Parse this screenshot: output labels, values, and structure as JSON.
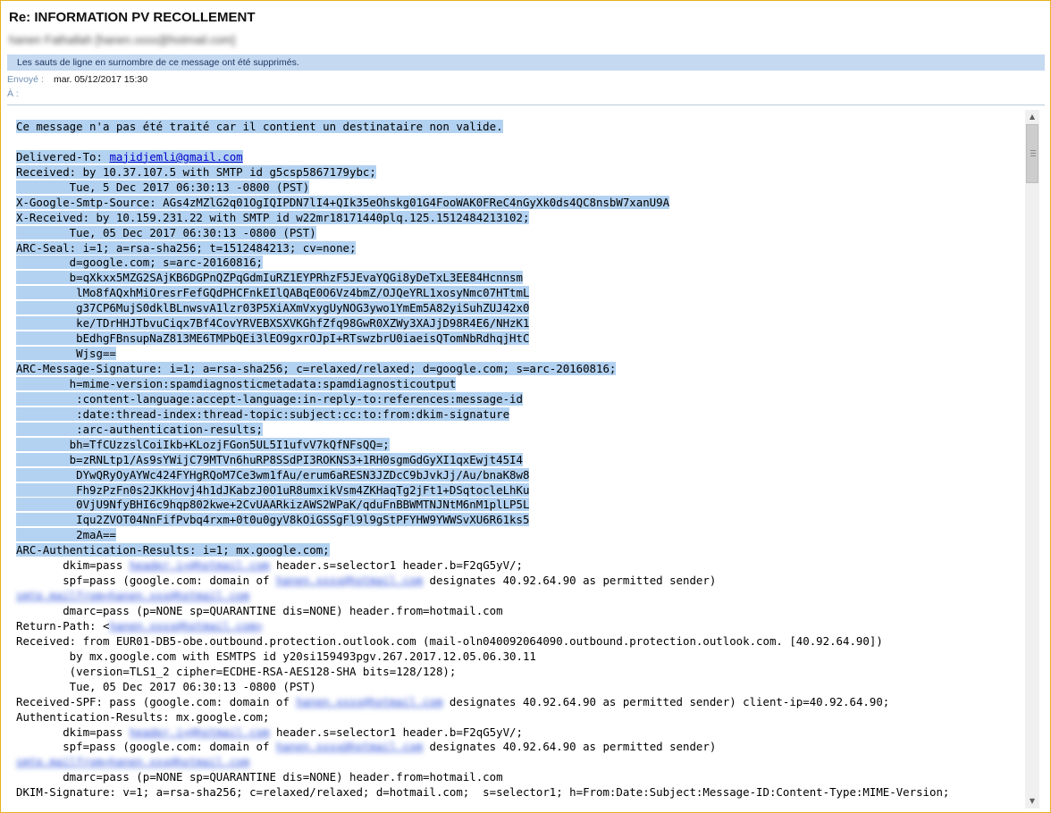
{
  "email": {
    "subject": "Re: INFORMATION PV RECOLLEMENT",
    "sender": "hanen Fathallah [hanen.xxxx@hotmail.com]",
    "info_bar": "Les sauts de ligne en surnombre de ce message ont été supprimés.",
    "sent_label": "Envoyé :",
    "sent_value": "mar. 05/12/2017 15:30",
    "to_label": "À :",
    "to_value": ""
  },
  "body_lines": [
    {
      "text": "Ce message n'a pas été traité car il contient un destinataire non valide.",
      "sel": true
    },
    {
      "text": "",
      "sel": false
    },
    {
      "text": "Delivered-To: ",
      "link": "majidjemli@gmail.com",
      "sel": true
    },
    {
      "text": "Received: by 10.37.107.5 with SMTP id g5csp5867179ybc;",
      "sel": true
    },
    {
      "text": "        Tue, 5 Dec 2017 06:30:13 -0800 (PST)",
      "sel": true
    },
    {
      "text": "X-Google-Smtp-Source: AGs4zMZlG2q01OgIQIPDN7lI4+QIk35eOhskg01G4FooWAK0FReC4nGyXk0ds4QC8nsbW7xanU9A",
      "sel": true
    },
    {
      "text": "X-Received: by 10.159.231.22 with SMTP id w22mr18171440plq.125.1512484213102;",
      "sel": true
    },
    {
      "text": "        Tue, 05 Dec 2017 06:30:13 -0800 (PST)",
      "sel": true
    },
    {
      "text": "ARC-Seal: i=1; a=rsa-sha256; t=1512484213; cv=none;",
      "sel": true
    },
    {
      "text": "        d=google.com; s=arc-20160816;",
      "sel": true
    },
    {
      "text": "        b=qXkxx5MZG2SAjKB6DGPnQZPqGdmIuRZ1EYPRhzF5JEvaYQGi8yDeTxL3EE84Hcnnsm",
      "sel": true
    },
    {
      "text": "         lMo8fAQxhMiOresrFefGQdPHCFnkEIlQABqE0O6Vz4bmZ/OJQeYRL1xosyNmc07HTtmL",
      "sel": true
    },
    {
      "text": "         g37CP6MujS0dklBLnwsvA1lzr03P5XiAXmVxygUyNOG3ywo1YmEm5A82yiSuhZUJ42x0",
      "sel": true
    },
    {
      "text": "         ke/TDrHHJTbvuCiqx7Bf4CovYRVEBXSXVKGhfZfq98GwR0XZWy3XAJjD98R4E6/NHzK1",
      "sel": true
    },
    {
      "text": "         bEdhgFBnsupNaZ813ME6TMPbQEi3lEO9gxrOJpI+RTswzbrU0iaeisQTomNbRdhqjHtC",
      "sel": true
    },
    {
      "text": "         Wjsg==",
      "sel": true
    },
    {
      "text": "ARC-Message-Signature: i=1; a=rsa-sha256; c=relaxed/relaxed; d=google.com; s=arc-20160816;",
      "sel": true
    },
    {
      "text": "        h=mime-version:spamdiagnosticmetadata:spamdiagnosticoutput",
      "sel": true
    },
    {
      "text": "         :content-language:accept-language:in-reply-to:references:message-id",
      "sel": true
    },
    {
      "text": "         :date:thread-index:thread-topic:subject:cc:to:from:dkim-signature",
      "sel": true
    },
    {
      "text": "         :arc-authentication-results;",
      "sel": true
    },
    {
      "text": "        bh=TfCUzzslCoiIkb+KLozjFGon5UL5I1ufvV7kQfNFsQQ=;",
      "sel": true
    },
    {
      "text": "        b=zRNLtp1/As9sYWijC79MTVn6huRP8SSdPI3ROKNS3+1RH0sgmGdGyXI1qxEwjt45I4",
      "sel": true
    },
    {
      "text": "         DYwQRyOyAYWc424FYHgRQoM7Ce3wm1fAu/erum6aRESN3JZDcC9bJvkJj/Au/bnaK8w8",
      "sel": true
    },
    {
      "text": "         Fh9zPzFn0s2JKkHovj4h1dJKabzJ0O1uR8umxikVsm4ZKHaqTg2jFt1+DSqtocleLhKu",
      "sel": true
    },
    {
      "text": "         0VjU9NfyBHI6c9hqp802kwe+2CvUAARkizAWS2WPaK/qduFnBBWMTNJNtM6nM1plLP5L",
      "sel": true
    },
    {
      "text": "         Iqu2ZVOT04NnFifPvbq4rxm+0t0u0gyV8kOiGSSgFl9l9gStPFYHW9YWWSvXU6R61ks5",
      "sel": true
    },
    {
      "text": "         2maA==",
      "sel": true
    },
    {
      "text": "ARC-Authentication-Results: i=1; mx.google.com;",
      "sel": true
    },
    {
      "text": "       dkim=pass ",
      "blur": "header.i=@hotmail.com",
      "tail": " header.s=selector1 header.b=F2qG5yV/;",
      "sel": false
    },
    {
      "text": "       spf=pass (google.com: domain of ",
      "blur": "hanen.xxxx@hotmail.com",
      "tail": " designates 40.92.64.90 as permitted sender)",
      "sel": false
    },
    {
      "text": "",
      "blur_line": "smtp.mailfrom=hanen.xxx@hotmail.com",
      "sel": false
    },
    {
      "text": "       dmarc=pass (p=NONE sp=QUARANTINE dis=NONE) header.from=hotmail.com",
      "sel": false
    },
    {
      "text": "Return-Path: <",
      "blur": "hanen.xxxx@hotmail.com>",
      "tail": "",
      "sel": false
    },
    {
      "text": "Received: from EUR01-DB5-obe.outbound.protection.outlook.com (mail-oln040092064090.outbound.protection.outlook.com. [40.92.64.90])",
      "sel": false
    },
    {
      "text": "        by mx.google.com with ESMTPS id y20si159493pgv.267.2017.12.05.06.30.11",
      "sel": false
    },
    {
      "text": "        (version=TLS1_2 cipher=ECDHE-RSA-AES128-SHA bits=128/128);",
      "sel": false
    },
    {
      "text": "        Tue, 05 Dec 2017 06:30:13 -0800 (PST)",
      "sel": false
    },
    {
      "text": "Received-SPF: pass (google.com: domain of ",
      "blur": "hanen.xxxx@hotmail.com",
      "tail": " designates 40.92.64.90 as permitted sender) client-ip=40.92.64.90;",
      "sel": false
    },
    {
      "text": "Authentication-Results: mx.google.com;",
      "sel": false
    },
    {
      "text": "       dkim=pass ",
      "blur": "header.i=@hotmail.com",
      "tail": " header.s=selector1 header.b=F2qG5yV/;",
      "sel": false
    },
    {
      "text": "       spf=pass (google.com: domain of ",
      "blur": "hanen.xxxx@hotmail.com",
      "tail": " designates 40.92.64.90 as permitted sender)",
      "sel": false
    },
    {
      "text": "",
      "blur_line": "smtp.mailfrom=hanen.xxx@hotmail.com",
      "sel": false
    },
    {
      "text": "       dmarc=pass (p=NONE sp=QUARANTINE dis=NONE) header.from=hotmail.com",
      "sel": false
    },
    {
      "text": "DKIM-Signature: v=1; a=rsa-sha256; c=relaxed/relaxed; d=hotmail.com;  s=selector1; h=From:Date:Subject:Message-ID:Content-Type:MIME-Version;",
      "sel": false
    }
  ],
  "scrollbar": {
    "up_icon": "▲",
    "down_icon": "▼"
  }
}
